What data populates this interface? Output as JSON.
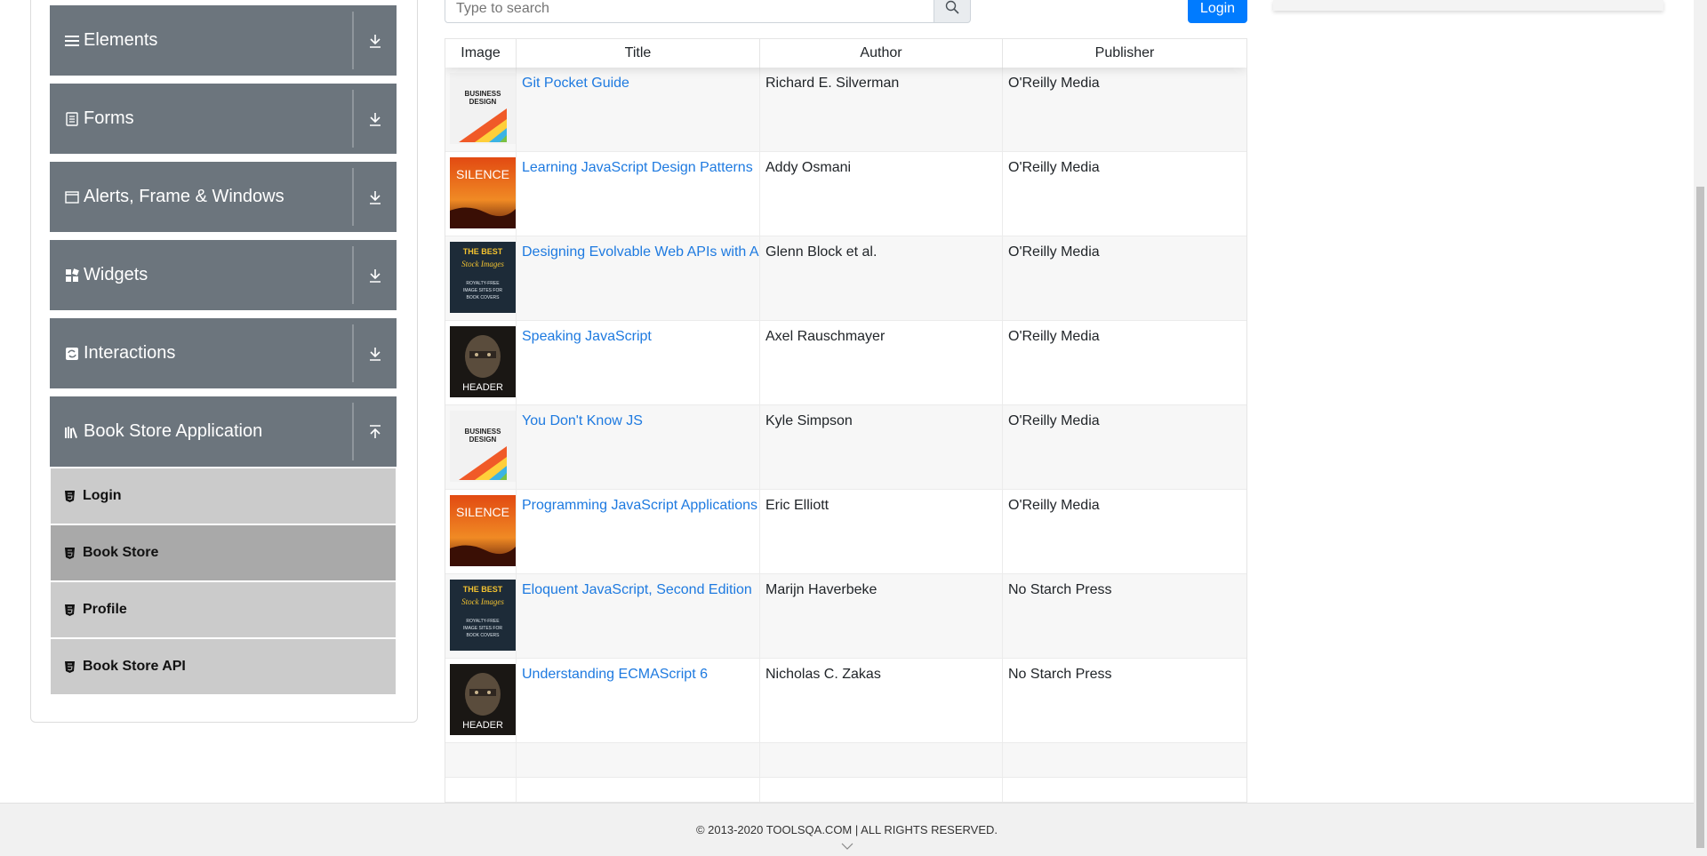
{
  "sidebar": {
    "groups": [
      {
        "label": "Elements",
        "icon": "hamburger-icon",
        "arrow": "download-arrow-icon"
      },
      {
        "label": "Forms",
        "icon": "form-icon",
        "arrow": "download-arrow-icon"
      },
      {
        "label": "Alerts, Frame & Windows",
        "icon": "window-icon",
        "arrow": "download-arrow-icon"
      },
      {
        "label": "Widgets",
        "icon": "widgets-icon",
        "arrow": "download-arrow-icon"
      },
      {
        "label": "Interactions",
        "icon": "interactions-icon",
        "arrow": "download-arrow-icon"
      },
      {
        "label": "Book Store Application",
        "icon": "books-icon",
        "arrow": "upload-arrow-icon"
      }
    ],
    "items": [
      {
        "label": "Login",
        "active": false
      },
      {
        "label": "Book Store",
        "active": true
      },
      {
        "label": "Profile",
        "active": false
      },
      {
        "label": "Book Store API",
        "active": false
      }
    ]
  },
  "search": {
    "placeholder": "Type to search"
  },
  "login_button": "Login",
  "table": {
    "headers": [
      "Image",
      "Title",
      "Author",
      "Publisher"
    ],
    "rows": [
      {
        "cover": "business-design-cover",
        "title": "Git Pocket Guide",
        "author": "Richard E. Silverman",
        "publisher": "O'Reilly Media"
      },
      {
        "cover": "silence-cover",
        "title": "Learning JavaScript Design Patterns",
        "author": "Addy Osmani",
        "publisher": "O'Reilly Media"
      },
      {
        "cover": "best-stock-images-cover",
        "title": "Designing Evolvable Web APIs with ASP.NET",
        "author": "Glenn Block et al.",
        "publisher": "O'Reilly Media"
      },
      {
        "cover": "header-cover",
        "title": "Speaking JavaScript",
        "author": "Axel Rauschmayer",
        "publisher": "O'Reilly Media"
      },
      {
        "cover": "business-design-cover",
        "title": "You Don't Know JS",
        "author": "Kyle Simpson",
        "publisher": "O'Reilly Media"
      },
      {
        "cover": "silence-cover",
        "title": "Programming JavaScript Applications",
        "author": "Eric Elliott",
        "publisher": "O'Reilly Media"
      },
      {
        "cover": "best-stock-images-cover",
        "title": "Eloquent JavaScript, Second Edition",
        "author": "Marijn Haverbeke",
        "publisher": "No Starch Press"
      },
      {
        "cover": "header-cover",
        "title": "Understanding ECMAScript 6",
        "author": "Nicholas C. Zakas",
        "publisher": "No Starch Press"
      }
    ]
  },
  "covers": {
    "business": {
      "line1": "BUSINESS",
      "line2": "DESIGN"
    },
    "silence": {
      "text": "SILENCE"
    },
    "stock": {
      "line1": "THE BEST",
      "line2": "Stock Images",
      "line3": "ROYALTY-FREE",
      "line4": "IMAGE SITES FOR",
      "line5": "BOOK COVERS"
    },
    "header": {
      "text": "HEADER"
    }
  },
  "footer": {
    "text": "© 2013-2020 TOOLSQA.COM | ALL RIGHTS RESERVED."
  },
  "colors": {
    "sidebar_group": "#6c757d",
    "sub_item": "#cbcbcb",
    "sub_item_active": "#a9a9a9",
    "link": "#1e7ae0",
    "login_button": "#007bff"
  }
}
